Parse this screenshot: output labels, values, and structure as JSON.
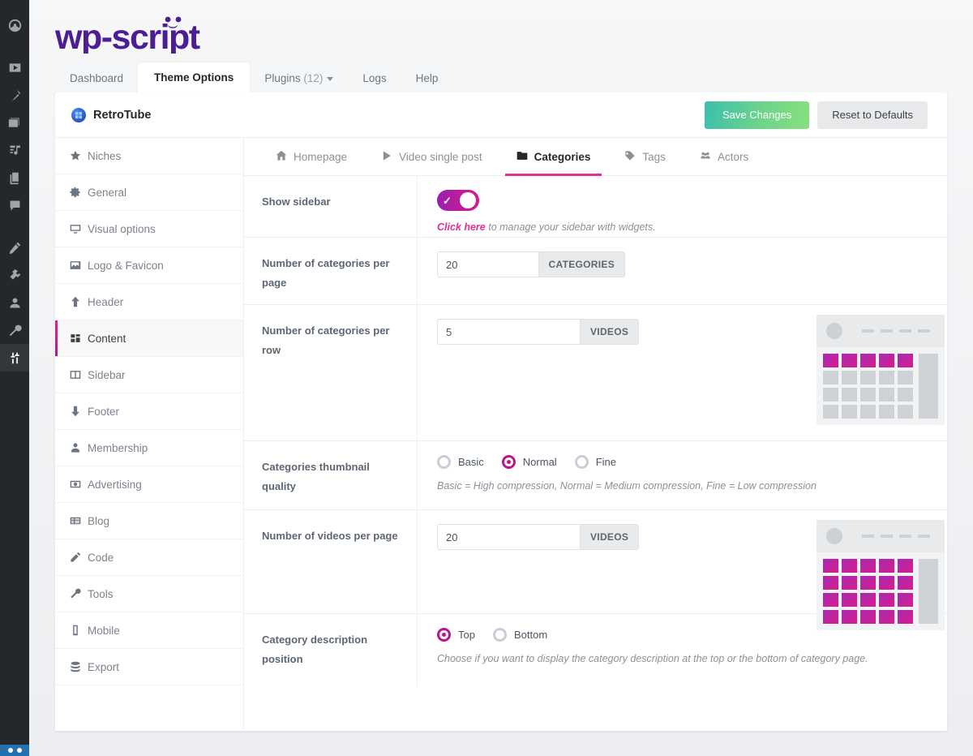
{
  "brand": {
    "logo_text": "wp-script"
  },
  "nav": {
    "tabs": [
      {
        "label": "Dashboard",
        "count": "",
        "active": false,
        "dropdown": false
      },
      {
        "label": "Theme Options",
        "count": "",
        "active": true,
        "dropdown": false
      },
      {
        "label": "Plugins",
        "count": "(12)",
        "active": false,
        "dropdown": true
      },
      {
        "label": "Logs",
        "count": "",
        "active": false,
        "dropdown": false
      },
      {
        "label": "Help",
        "count": "",
        "active": false,
        "dropdown": false
      }
    ]
  },
  "panel_header": {
    "theme_name": "RetroTube",
    "badge_icon": "theme-badge-icon",
    "save_label": "Save Changes",
    "reset_label": "Reset to Defaults"
  },
  "sidebar": {
    "items": [
      {
        "label": "Niches",
        "icon": "star-icon",
        "active": false
      },
      {
        "label": "General",
        "icon": "gear-icon",
        "active": false
      },
      {
        "label": "Visual options",
        "icon": "desktop-icon",
        "active": false
      },
      {
        "label": "Logo & Favicon",
        "icon": "image-icon",
        "active": false
      },
      {
        "label": "Header",
        "icon": "arrow-up-icon",
        "active": false
      },
      {
        "label": "Content",
        "icon": "grid-icon",
        "active": true
      },
      {
        "label": "Sidebar",
        "icon": "columns-icon",
        "active": false
      },
      {
        "label": "Footer",
        "icon": "arrow-down-icon",
        "active": false
      },
      {
        "label": "Membership",
        "icon": "user-icon",
        "active": false
      },
      {
        "label": "Advertising",
        "icon": "money-icon",
        "active": false
      },
      {
        "label": "Blog",
        "icon": "list-alt-icon",
        "active": false
      },
      {
        "label": "Code",
        "icon": "pencil-icon",
        "active": false
      },
      {
        "label": "Tools",
        "icon": "wrench-icon",
        "active": false
      },
      {
        "label": "Mobile",
        "icon": "mobile-icon",
        "active": false
      },
      {
        "label": "Export",
        "icon": "database-icon",
        "active": false
      }
    ]
  },
  "subtabs": [
    {
      "label": "Homepage",
      "icon": "home-icon",
      "active": false
    },
    {
      "label": "Video single post",
      "icon": "play-icon",
      "active": false
    },
    {
      "label": "Categories",
      "icon": "folder-icon",
      "active": true
    },
    {
      "label": "Tags",
      "icon": "tag-icon",
      "active": false
    },
    {
      "label": "Actors",
      "icon": "users-icon",
      "active": false
    }
  ],
  "settings": {
    "show_sidebar": {
      "label": "Show sidebar",
      "toggle_on": true,
      "toggle_icon": "check-icon",
      "help_link": "Click here",
      "help_rest": " to manage your sidebar with widgets."
    },
    "categories_per_page": {
      "label": "Number of categories per page",
      "value": "20",
      "suffix": "CATEGORIES"
    },
    "categories_per_row": {
      "label": "Number of categories per row",
      "value": "5",
      "suffix": "VIDEOS",
      "preview": {
        "rows": 4,
        "cols": 5,
        "highlighted": 5
      }
    },
    "thumbnail_quality": {
      "label": "Categories thumbnail quality",
      "options": [
        {
          "label": "Basic",
          "selected": false
        },
        {
          "label": "Normal",
          "selected": true
        },
        {
          "label": "Fine",
          "selected": false
        }
      ],
      "note": "Basic = High compression, Normal = Medium compression, Fine = Low compression"
    },
    "videos_per_page": {
      "label": "Number of videos per page",
      "value": "20",
      "suffix": "VIDEOS",
      "preview": {
        "rows": 4,
        "cols": 5,
        "highlighted": 20
      }
    },
    "description_position": {
      "label": "Category description position",
      "options": [
        {
          "label": "Top",
          "selected": true
        },
        {
          "label": "Bottom",
          "selected": false
        }
      ],
      "note": "Choose if you want to display the category description at the top or the bottom of category page."
    }
  },
  "wp_rail": {
    "items": [
      {
        "icon": "dashboard-icon",
        "current": false
      },
      {
        "icon": "video-icon",
        "current": false
      },
      {
        "icon": "pin-icon",
        "current": false
      },
      {
        "icon": "media-icon",
        "current": false
      },
      {
        "icon": "music-icon",
        "current": false
      },
      {
        "icon": "pages-icon",
        "current": false
      },
      {
        "icon": "comments-icon",
        "current": false
      },
      {
        "icon": "appearance-icon",
        "current": false
      },
      {
        "icon": "plugins-icon",
        "current": false
      },
      {
        "icon": "users-icon",
        "current": false
      },
      {
        "icon": "tools-icon",
        "current": false
      },
      {
        "icon": "settings-icon",
        "current": true
      }
    ]
  },
  "colors": {
    "accent_pink": "#e0328f",
    "accent_purple": "#9b1fae",
    "save_green": "#6fd48a",
    "rail_dark": "#23282d"
  }
}
